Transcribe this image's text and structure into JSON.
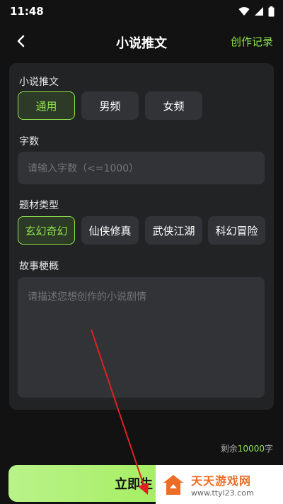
{
  "status_bar": {
    "time": "11:48"
  },
  "nav": {
    "title": "小说推文",
    "record_label": "创作记录"
  },
  "form": {
    "category": {
      "label": "小说推文",
      "options": [
        "通用",
        "男频",
        "女频"
      ],
      "selected_index": 0
    },
    "word_count": {
      "label": "字数",
      "placeholder": "请输入字数（<=1000）"
    },
    "genre": {
      "label": "题材类型",
      "options": [
        "玄幻奇幻",
        "仙侠修真",
        "武侠江湖",
        "科幻冒险"
      ],
      "selected_index": 0
    },
    "synopsis": {
      "label": "故事梗概",
      "placeholder": "请描述您想创作的小说剧情"
    }
  },
  "remaining": {
    "prefix": "剩余",
    "count": "10000",
    "suffix": "字"
  },
  "generate_button": {
    "label": "立即生"
  },
  "watermark": {
    "title": "天天游戏网",
    "url": "www.ttyl23.com"
  },
  "colors": {
    "accent": "#8ee44b",
    "background": "#121212",
    "card": "#222325",
    "chip": "#323336",
    "annotation_arrow": "#e02020"
  }
}
